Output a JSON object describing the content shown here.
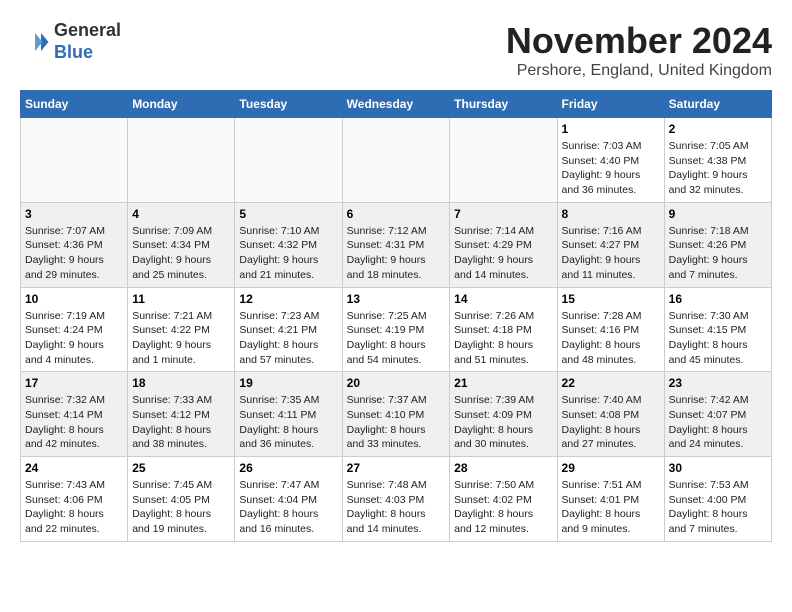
{
  "header": {
    "logo_general": "General",
    "logo_blue": "Blue",
    "month": "November 2024",
    "location": "Pershore, England, United Kingdom"
  },
  "weekdays": [
    "Sunday",
    "Monday",
    "Tuesday",
    "Wednesday",
    "Thursday",
    "Friday",
    "Saturday"
  ],
  "weeks": [
    [
      {
        "day": "",
        "info": ""
      },
      {
        "day": "",
        "info": ""
      },
      {
        "day": "",
        "info": ""
      },
      {
        "day": "",
        "info": ""
      },
      {
        "day": "",
        "info": ""
      },
      {
        "day": "1",
        "info": "Sunrise: 7:03 AM\nSunset: 4:40 PM\nDaylight: 9 hours\nand 36 minutes."
      },
      {
        "day": "2",
        "info": "Sunrise: 7:05 AM\nSunset: 4:38 PM\nDaylight: 9 hours\nand 32 minutes."
      }
    ],
    [
      {
        "day": "3",
        "info": "Sunrise: 7:07 AM\nSunset: 4:36 PM\nDaylight: 9 hours\nand 29 minutes."
      },
      {
        "day": "4",
        "info": "Sunrise: 7:09 AM\nSunset: 4:34 PM\nDaylight: 9 hours\nand 25 minutes."
      },
      {
        "day": "5",
        "info": "Sunrise: 7:10 AM\nSunset: 4:32 PM\nDaylight: 9 hours\nand 21 minutes."
      },
      {
        "day": "6",
        "info": "Sunrise: 7:12 AM\nSunset: 4:31 PM\nDaylight: 9 hours\nand 18 minutes."
      },
      {
        "day": "7",
        "info": "Sunrise: 7:14 AM\nSunset: 4:29 PM\nDaylight: 9 hours\nand 14 minutes."
      },
      {
        "day": "8",
        "info": "Sunrise: 7:16 AM\nSunset: 4:27 PM\nDaylight: 9 hours\nand 11 minutes."
      },
      {
        "day": "9",
        "info": "Sunrise: 7:18 AM\nSunset: 4:26 PM\nDaylight: 9 hours\nand 7 minutes."
      }
    ],
    [
      {
        "day": "10",
        "info": "Sunrise: 7:19 AM\nSunset: 4:24 PM\nDaylight: 9 hours\nand 4 minutes."
      },
      {
        "day": "11",
        "info": "Sunrise: 7:21 AM\nSunset: 4:22 PM\nDaylight: 9 hours\nand 1 minute."
      },
      {
        "day": "12",
        "info": "Sunrise: 7:23 AM\nSunset: 4:21 PM\nDaylight: 8 hours\nand 57 minutes."
      },
      {
        "day": "13",
        "info": "Sunrise: 7:25 AM\nSunset: 4:19 PM\nDaylight: 8 hours\nand 54 minutes."
      },
      {
        "day": "14",
        "info": "Sunrise: 7:26 AM\nSunset: 4:18 PM\nDaylight: 8 hours\nand 51 minutes."
      },
      {
        "day": "15",
        "info": "Sunrise: 7:28 AM\nSunset: 4:16 PM\nDaylight: 8 hours\nand 48 minutes."
      },
      {
        "day": "16",
        "info": "Sunrise: 7:30 AM\nSunset: 4:15 PM\nDaylight: 8 hours\nand 45 minutes."
      }
    ],
    [
      {
        "day": "17",
        "info": "Sunrise: 7:32 AM\nSunset: 4:14 PM\nDaylight: 8 hours\nand 42 minutes."
      },
      {
        "day": "18",
        "info": "Sunrise: 7:33 AM\nSunset: 4:12 PM\nDaylight: 8 hours\nand 38 minutes."
      },
      {
        "day": "19",
        "info": "Sunrise: 7:35 AM\nSunset: 4:11 PM\nDaylight: 8 hours\nand 36 minutes."
      },
      {
        "day": "20",
        "info": "Sunrise: 7:37 AM\nSunset: 4:10 PM\nDaylight: 8 hours\nand 33 minutes."
      },
      {
        "day": "21",
        "info": "Sunrise: 7:39 AM\nSunset: 4:09 PM\nDaylight: 8 hours\nand 30 minutes."
      },
      {
        "day": "22",
        "info": "Sunrise: 7:40 AM\nSunset: 4:08 PM\nDaylight: 8 hours\nand 27 minutes."
      },
      {
        "day": "23",
        "info": "Sunrise: 7:42 AM\nSunset: 4:07 PM\nDaylight: 8 hours\nand 24 minutes."
      }
    ],
    [
      {
        "day": "24",
        "info": "Sunrise: 7:43 AM\nSunset: 4:06 PM\nDaylight: 8 hours\nand 22 minutes."
      },
      {
        "day": "25",
        "info": "Sunrise: 7:45 AM\nSunset: 4:05 PM\nDaylight: 8 hours\nand 19 minutes."
      },
      {
        "day": "26",
        "info": "Sunrise: 7:47 AM\nSunset: 4:04 PM\nDaylight: 8 hours\nand 16 minutes."
      },
      {
        "day": "27",
        "info": "Sunrise: 7:48 AM\nSunset: 4:03 PM\nDaylight: 8 hours\nand 14 minutes."
      },
      {
        "day": "28",
        "info": "Sunrise: 7:50 AM\nSunset: 4:02 PM\nDaylight: 8 hours\nand 12 minutes."
      },
      {
        "day": "29",
        "info": "Sunrise: 7:51 AM\nSunset: 4:01 PM\nDaylight: 8 hours\nand 9 minutes."
      },
      {
        "day": "30",
        "info": "Sunrise: 7:53 AM\nSunset: 4:00 PM\nDaylight: 8 hours\nand 7 minutes."
      }
    ]
  ]
}
